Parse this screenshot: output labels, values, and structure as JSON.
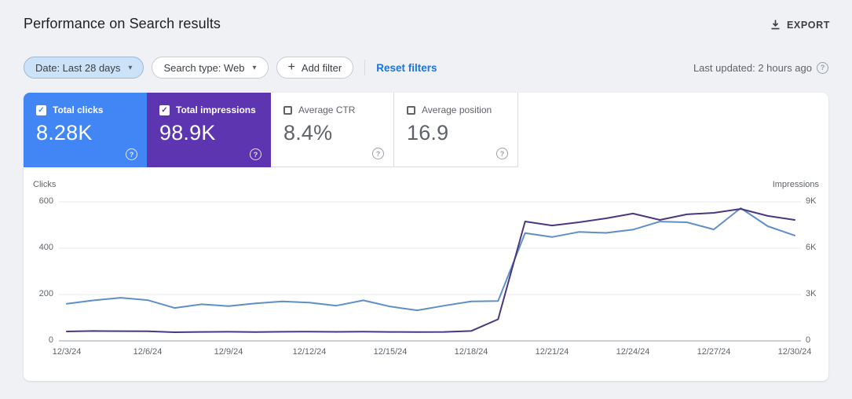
{
  "page": {
    "title": "Performance on Search results"
  },
  "header": {
    "export_label": "EXPORT"
  },
  "icons": {
    "caret": "▾",
    "plus": "+",
    "help": "?",
    "check": "✓"
  },
  "filters": {
    "date_chip": "Date: Last 28 days",
    "search_type_chip": "Search type: Web",
    "add_filter_label": "Add filter",
    "reset_label": "Reset filters",
    "last_updated": "Last updated: 2 hours ago"
  },
  "metric_cards": [
    {
      "label": "Total clicks",
      "value": "8.28K",
      "checked": true,
      "color": "#4285f4"
    },
    {
      "label": "Total impressions",
      "value": "98.9K",
      "checked": true,
      "color": "#5e35b1"
    },
    {
      "label": "Average CTR",
      "value": "8.4%",
      "checked": false
    },
    {
      "label": "Average position",
      "value": "16.9",
      "checked": false
    }
  ],
  "chart_data": {
    "type": "line",
    "x": [
      "12/3/24",
      "12/4/24",
      "12/5/24",
      "12/6/24",
      "12/7/24",
      "12/8/24",
      "12/9/24",
      "12/10/24",
      "12/11/24",
      "12/12/24",
      "12/13/24",
      "12/14/24",
      "12/15/24",
      "12/16/24",
      "12/17/24",
      "12/18/24",
      "12/19/24",
      "12/20/24",
      "12/21/24",
      "12/22/24",
      "12/23/24",
      "12/24/24",
      "12/25/24",
      "12/26/24",
      "12/27/24",
      "12/28/24",
      "12/29/24",
      "12/30/24"
    ],
    "x_tick_labels": [
      "12/3/24",
      "12/6/24",
      "12/9/24",
      "12/12/24",
      "12/15/24",
      "12/18/24",
      "12/21/24",
      "12/24/24",
      "12/27/24",
      "12/30/24"
    ],
    "series": [
      {
        "name": "Clicks",
        "axis": "left",
        "color": "#5f8fc7",
        "values": [
          160,
          175,
          186,
          176,
          142,
          158,
          150,
          162,
          170,
          165,
          152,
          175,
          148,
          132,
          152,
          170,
          172,
          465,
          448,
          470,
          466,
          480,
          515,
          512,
          481,
          573,
          495,
          455
        ]
      },
      {
        "name": "Impressions",
        "axis": "right",
        "color": "#4a3780",
        "values": [
          610,
          640,
          630,
          620,
          560,
          580,
          590,
          575,
          590,
          600,
          585,
          595,
          580,
          570,
          580,
          640,
          1400,
          7730,
          7470,
          7680,
          7930,
          8240,
          7830,
          8190,
          8290,
          8540,
          8090,
          7830
        ]
      }
    ],
    "left_axis": {
      "label": "Clicks",
      "ticks": [
        "600",
        "400",
        "200",
        "0"
      ],
      "max": 600
    },
    "right_axis": {
      "label": "Impressions",
      "ticks": [
        "9K",
        "6K",
        "3K",
        "0"
      ],
      "max": 9000
    },
    "grid": true,
    "legend_position": "none"
  }
}
